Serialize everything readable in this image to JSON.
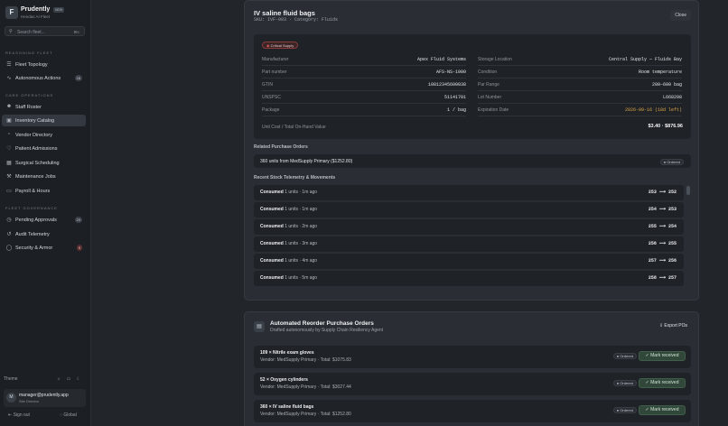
{
  "brand": {
    "logo": "F",
    "name": "Prudently",
    "badge": "NEW",
    "subtitle": "Hendas AI Fleet"
  },
  "search": {
    "icon": "search-icon",
    "placeholder": "Search fleet...",
    "shortcut": "⌘K"
  },
  "sidebar": {
    "section_fleet": "Reasoning Fleet",
    "fleet_items": [
      {
        "label": "Fleet Topology",
        "icon": "list-icon"
      },
      {
        "label": "Autonomous Actions",
        "icon": "activity-icon",
        "badge": "28"
      }
    ],
    "section_ops": "Care Operations",
    "ops_items": [
      {
        "label": "Staff Roster",
        "icon": "user-icon"
      },
      {
        "label": "Inventory Catalog",
        "icon": "box-icon"
      },
      {
        "label": "Vendor Directory",
        "icon": "folder-icon"
      },
      {
        "label": "Patient Admissions",
        "icon": "heart-icon"
      },
      {
        "label": "Surgical Scheduling",
        "icon": "calendar-icon"
      },
      {
        "label": "Maintenance Jobs",
        "icon": "wrench-icon"
      },
      {
        "label": "Payroll & Hours",
        "icon": "wallet-icon"
      }
    ],
    "section_gov": "Fleet Governance",
    "gov_items": [
      {
        "label": "Pending Approvals",
        "icon": "clock-icon",
        "badge": "29"
      },
      {
        "label": "Audit Telemetry",
        "icon": "history-icon"
      },
      {
        "label": "Security & Armor",
        "icon": "shield-icon",
        "badge": "9"
      }
    ],
    "theme_label": "Theme",
    "user": {
      "initial": "M",
      "email": "manager@prudently.app",
      "role": "Site Director"
    },
    "sign_out": "Sign out",
    "global": "Global"
  },
  "modal": {
    "title": "IV saline fluid bags",
    "subtitle": "SKU: IVF-003 · Category: Fluids",
    "close": "Close",
    "critical": "Critical Supply",
    "fields_left": [
      {
        "k": "Manufacturer",
        "v": "Apex Fluid Systems"
      },
      {
        "k": "Part number",
        "v": "AFS-NS-1000"
      },
      {
        "k": "GTIN",
        "v": "10812345600038"
      },
      {
        "k": "UNSPSC",
        "v": "51141701"
      },
      {
        "k": "Package",
        "v": "1 / bag"
      }
    ],
    "fields_right": [
      {
        "k": "Storage Location",
        "v": "Central Supply — Fluids Bay"
      },
      {
        "k": "Condition",
        "v": "Room temperature"
      },
      {
        "k": "Par Range",
        "v": "200–600 bag"
      },
      {
        "k": "Lot Number",
        "v": "L668298"
      },
      {
        "k": "Expiration Date",
        "v": "2026-09-16 (18d left)"
      }
    ],
    "unit_cost_label": "Unit Cost / Total On-Hand Value",
    "unit_cost_value": "$3.40 · $876.96",
    "related_header": "Related Purchase Orders",
    "related_po": {
      "text": "360 units from MedSupply Primary ($1252.80)",
      "status": "Ordered"
    },
    "telemetry_header": "Recent Stock Telemetry & Movements",
    "telemetry": [
      {
        "action": "Consumed",
        "qty": "1",
        "time": "units · 1m ago",
        "change": "253 ⟶ 252"
      },
      {
        "action": "Consumed",
        "qty": "1",
        "time": "units · 1m ago",
        "change": "254 ⟶ 253"
      },
      {
        "action": "Consumed",
        "qty": "1",
        "time": "units · 2m ago",
        "change": "255 ⟶ 254"
      },
      {
        "action": "Consumed",
        "qty": "1",
        "time": "units · 3m ago",
        "change": "256 ⟶ 255"
      },
      {
        "action": "Consumed",
        "qty": "1",
        "time": "units · 4m ago",
        "change": "257 ⟶ 256"
      },
      {
        "action": "Consumed",
        "qty": "1",
        "time": "units · 5m ago",
        "change": "258 ⟶ 257"
      }
    ]
  },
  "reorder": {
    "icon": "document-icon",
    "title": "Automated Reorder Purchase Orders",
    "subtitle": "Drafted autonomously by Supply Chain Resiliency Agent",
    "export": "Export POs",
    "items": [
      {
        "name": "109 × Nitrile exam gloves",
        "detail": "Vendor: MedSupply Primary · Total: $1075.83",
        "status": "Ordered",
        "action": "Mark received"
      },
      {
        "name": "52 × Oxygen cylinders",
        "detail": "Vendor: MedSupply Primary · Total: $3027.44",
        "status": "Ordered",
        "action": "Mark received"
      },
      {
        "name": "360 × IV saline fluid bags",
        "detail": "Vendor: MedSupply Primary · Total: $1252.80",
        "status": "Ordered",
        "action": "Mark received"
      }
    ]
  }
}
